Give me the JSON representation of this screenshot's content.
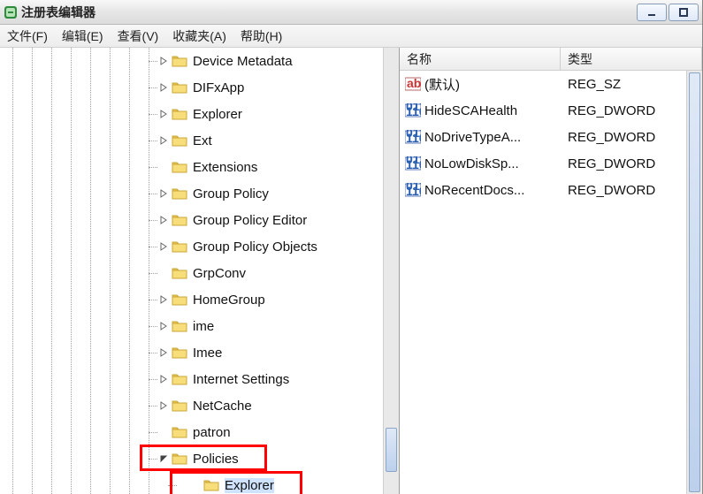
{
  "window": {
    "title": "注册表编辑器"
  },
  "menu": {
    "file": "文件(F)",
    "edit": "编辑(E)",
    "view": "查看(V)",
    "fav": "收藏夹(A)",
    "help": "帮助(H)"
  },
  "tree": {
    "items": [
      {
        "label": "Device Metadata",
        "expander": "closed"
      },
      {
        "label": "DIFxApp",
        "expander": "closed"
      },
      {
        "label": "Explorer",
        "expander": "closed"
      },
      {
        "label": "Ext",
        "expander": "closed"
      },
      {
        "label": "Extensions",
        "expander": "none"
      },
      {
        "label": "Group Policy",
        "expander": "closed"
      },
      {
        "label": "Group Policy Editor",
        "expander": "closed"
      },
      {
        "label": "Group Policy Objects",
        "expander": "closed"
      },
      {
        "label": "GrpConv",
        "expander": "none"
      },
      {
        "label": "HomeGroup",
        "expander": "closed"
      },
      {
        "label": "ime",
        "expander": "closed"
      },
      {
        "label": "Imee",
        "expander": "closed"
      },
      {
        "label": "Internet Settings",
        "expander": "closed"
      },
      {
        "label": "NetCache",
        "expander": "closed"
      },
      {
        "label": "patron",
        "expander": "none"
      },
      {
        "label": "Policies",
        "expander": "open",
        "highlight": true
      },
      {
        "label": "Explorer",
        "expander": "none",
        "child": true,
        "highlight": true,
        "selected": true
      }
    ]
  },
  "list": {
    "columns": {
      "name": "名称",
      "type": "类型"
    },
    "rows": [
      {
        "name": "(默认)",
        "type": "REG_SZ",
        "kind": "sz"
      },
      {
        "name": "HideSCAHealth",
        "type": "REG_DWORD",
        "kind": "dw"
      },
      {
        "name": "NoDriveTypeA...",
        "type": "REG_DWORD",
        "kind": "dw"
      },
      {
        "name": "NoLowDiskSp...",
        "type": "REG_DWORD",
        "kind": "dw"
      },
      {
        "name": "NoRecentDocs...",
        "type": "REG_DWORD",
        "kind": "dw"
      }
    ]
  }
}
